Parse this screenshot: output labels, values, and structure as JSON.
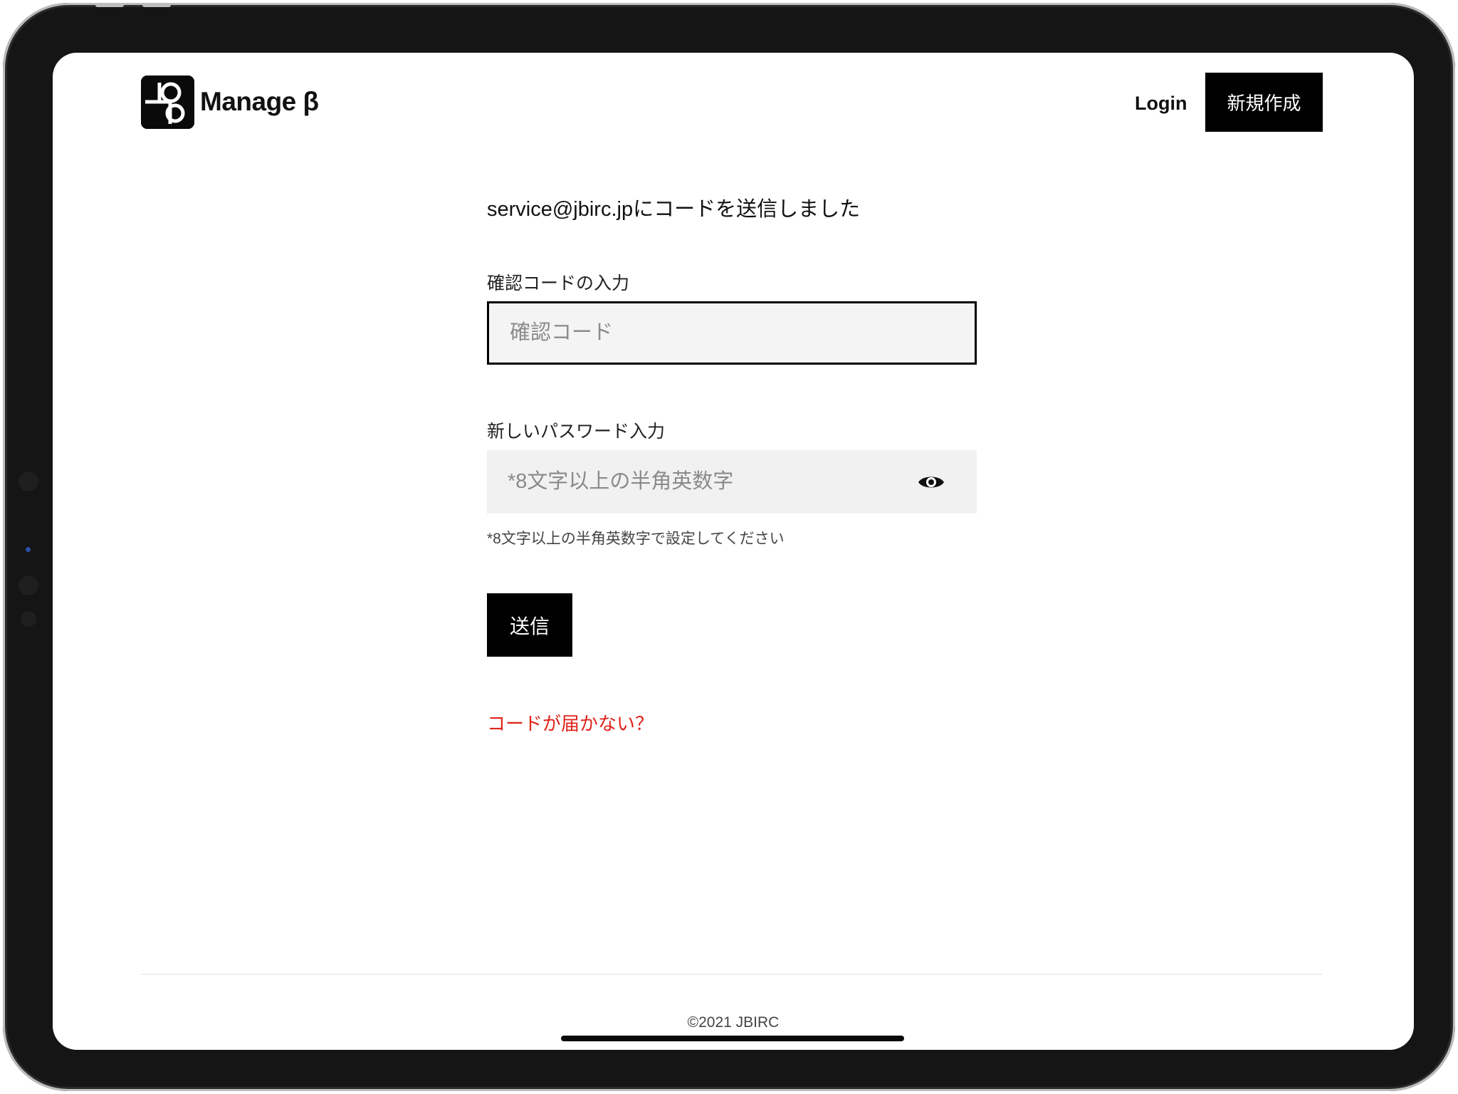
{
  "app": {
    "logo_text": "Manage β"
  },
  "header": {
    "login_label": "Login",
    "new_label": "新規作成"
  },
  "main": {
    "sent_message": "service@jbirc.jpにコードを送信しました",
    "code_label": "確認コードの入力",
    "code_placeholder": "確認コード",
    "code_value": "",
    "password_label": "新しいパスワード入力",
    "password_placeholder": "*8文字以上の半角英数字",
    "password_value": "",
    "password_hint": "*8文字以上の半角英数字で設定してください",
    "submit_label": "送信",
    "no_code_link": "コードが届かない？"
  },
  "footer": {
    "copyright": "©2021 JBIRC"
  },
  "icons": {
    "password_toggle": "eye-icon",
    "logo": "logo-mark-icon"
  },
  "colors": {
    "primary": "#000000",
    "link": "#e0231b",
    "field_bg": "#f1f1f1"
  }
}
